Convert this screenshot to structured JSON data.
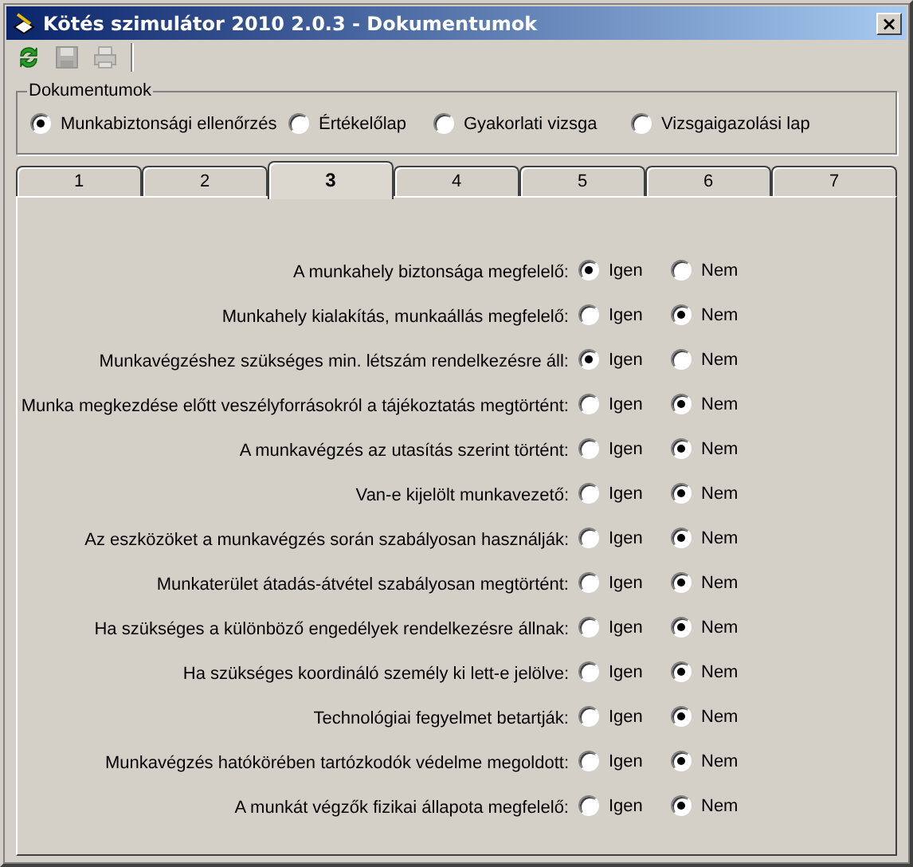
{
  "window": {
    "title": "Kötés szimulátor 2010 2.0.3 - Dokumentumok",
    "close": "×"
  },
  "toolbar": [
    {
      "kind": "refresh",
      "disabled": false
    },
    {
      "kind": "save",
      "disabled": true
    },
    {
      "kind": "print",
      "disabled": true
    }
  ],
  "documents_group": {
    "title": "Dokumentumok",
    "options": [
      {
        "label": "Munkabiztonsági ellenőrzés",
        "selected": true
      },
      {
        "label": "Értékelőlap",
        "selected": false
      },
      {
        "label": "Gyakorlati vizsga",
        "selected": false
      },
      {
        "label": "Vizsgaigazolási lap",
        "selected": false
      }
    ]
  },
  "tabs": [
    {
      "label": "1",
      "selected": false
    },
    {
      "label": "2",
      "selected": false
    },
    {
      "label": "3",
      "selected": true
    },
    {
      "label": "4",
      "selected": false
    },
    {
      "label": "5",
      "selected": false
    },
    {
      "label": "6",
      "selected": false
    },
    {
      "label": "7",
      "selected": false
    }
  ],
  "questions": [
    {
      "label": "A munkahely biztonsága megfelelő:",
      "options": [
        {
          "label": "Igen",
          "selected": true
        },
        {
          "label": "Nem",
          "selected": false
        }
      ]
    },
    {
      "label": "Munkahely kialakítás, munkaállás megfelelő:",
      "options": [
        {
          "label": "Igen",
          "selected": false
        },
        {
          "label": "Nem",
          "selected": true
        }
      ]
    },
    {
      "label": "Munkavégzéshez szükséges min. létszám rendelkezésre áll:",
      "options": [
        {
          "label": "Igen",
          "selected": true
        },
        {
          "label": "Nem",
          "selected": false
        }
      ]
    },
    {
      "label": "Munka megkezdése előtt veszélyforrásokról a tájékoztatás megtörtént:",
      "options": [
        {
          "label": "Igen",
          "selected": false
        },
        {
          "label": "Nem",
          "selected": true
        }
      ]
    },
    {
      "label": "A munkavégzés az utasítás szerint történt:",
      "options": [
        {
          "label": "Igen",
          "selected": false
        },
        {
          "label": "Nem",
          "selected": true
        }
      ]
    },
    {
      "label": "Van-e kijelölt munkavezető:",
      "options": [
        {
          "label": "Igen",
          "selected": false
        },
        {
          "label": "Nem",
          "selected": true
        }
      ]
    },
    {
      "label": "Az eszközöket a munkavégzés során szabályosan használják:",
      "options": [
        {
          "label": "Igen",
          "selected": false
        },
        {
          "label": "Nem",
          "selected": true
        }
      ]
    },
    {
      "label": "Munkaterület átadás-átvétel szabályosan megtörtént:",
      "options": [
        {
          "label": "Igen",
          "selected": false
        },
        {
          "label": "Nem",
          "selected": true
        }
      ]
    },
    {
      "label": "Ha szükséges a különböző engedélyek rendelkezésre állnak:",
      "options": [
        {
          "label": "Igen",
          "selected": false
        },
        {
          "label": "Nem",
          "selected": true
        }
      ]
    },
    {
      "label": "Ha szükséges koordináló személy ki lett-e jelölve:",
      "options": [
        {
          "label": "Igen",
          "selected": false
        },
        {
          "label": "Nem",
          "selected": true
        }
      ]
    },
    {
      "label": "Technológiai fegyelmet betartják:",
      "options": [
        {
          "label": "Igen",
          "selected": false
        },
        {
          "label": "Nem",
          "selected": true
        }
      ]
    },
    {
      "label": "Munkavégzés hatókörében tartózkodók védelme megoldott:",
      "options": [
        {
          "label": "Igen",
          "selected": false
        },
        {
          "label": "Nem",
          "selected": true
        }
      ]
    },
    {
      "label": "A munkát végzők fizikai állapota megfelelő:",
      "options": [
        {
          "label": "Igen",
          "selected": false
        },
        {
          "label": "Nem",
          "selected": true
        }
      ]
    }
  ]
}
